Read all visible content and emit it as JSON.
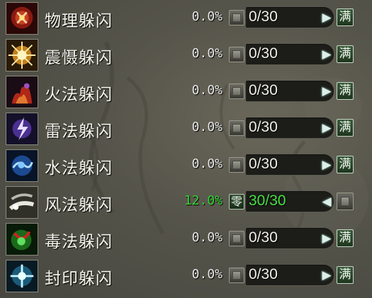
{
  "rows": [
    {
      "name": "物理躲闪",
      "percent": "0.0%",
      "points": "0/30",
      "icon": "physical-dodge-icon",
      "active": false
    },
    {
      "name": "震慑躲闪",
      "percent": "0.0%",
      "points": "0/30",
      "icon": "shock-dodge-icon",
      "active": false
    },
    {
      "name": "火法躲闪",
      "percent": "0.0%",
      "points": "0/30",
      "icon": "fire-dodge-icon",
      "active": false
    },
    {
      "name": "雷法躲闪",
      "percent": "0.0%",
      "points": "0/30",
      "icon": "thunder-dodge-icon",
      "active": false
    },
    {
      "name": "水法躲闪",
      "percent": "0.0%",
      "points": "0/30",
      "icon": "water-dodge-icon",
      "active": false
    },
    {
      "name": "风法躲闪",
      "percent": "12.0%",
      "points": "30/30",
      "icon": "wind-dodge-icon",
      "active": true
    },
    {
      "name": "毒法躲闪",
      "percent": "0.0%",
      "points": "0/30",
      "icon": "poison-dodge-icon",
      "active": false
    },
    {
      "name": "封印躲闪",
      "percent": "0.0%",
      "points": "0/30",
      "icon": "seal-dodge-icon",
      "active": false
    }
  ],
  "labels": {
    "max": "满",
    "reset": "零"
  },
  "colors": {
    "active_value": "#33d233",
    "text": "#f4f4ec",
    "accent_button": "#2e4a2e"
  }
}
